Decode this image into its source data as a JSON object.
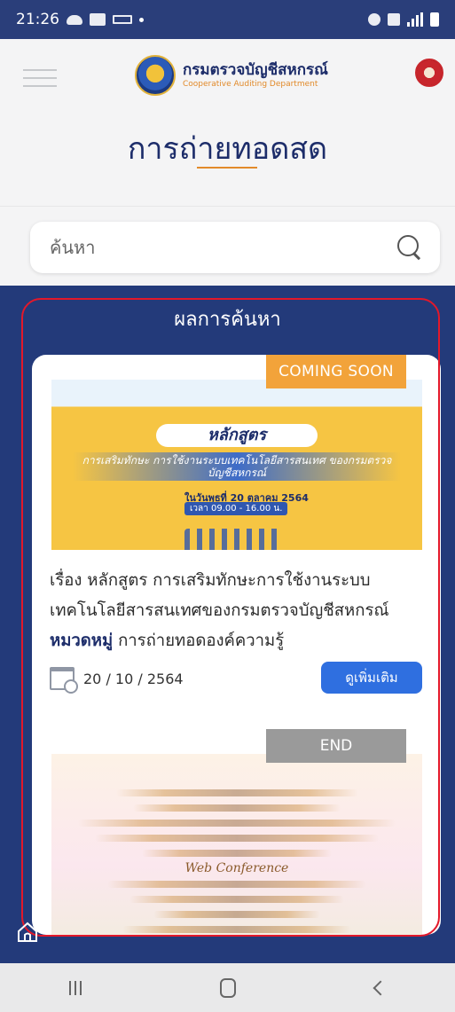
{
  "status_bar": {
    "time": "21:26"
  },
  "header": {
    "logo_th": "กรมตรวจบัญชีสหกรณ์",
    "logo_en": "Cooperative Auditing Department",
    "page_title": "การถ่ายทอดสด"
  },
  "search": {
    "placeholder": "ค้นหา"
  },
  "results": {
    "title": "ผลการค้นหา",
    "items": [
      {
        "tag": "COMING SOON",
        "banner": {
          "heading": "หลักสูตร",
          "subtitle": "การเสริมทักษะ การใช้งานระบบเทคโนโลยีสารสนเทศ ของกรมตรวจบัญชีสหกรณ์",
          "date": "ในวันพุธที่ 20 ตุลาคม 2564",
          "time": "เวลา 09.00 - 16.00 น."
        },
        "subject_label": "เรื่อง",
        "subject": "หลักสูตร การเสริมทักษะการใช้งานระบบเทคโนโลยีสารสนเทศของกรมตรวจบัญชีสหกรณ์",
        "category_label": "หมวดหมู่",
        "category": "การถ่ายทอดองค์ความรู้",
        "date": "20 / 10 / 2564",
        "more_label": "ดูเพิ่มเติม"
      },
      {
        "tag": "END",
        "banner": {
          "line1": "Web Conference"
        }
      }
    ]
  },
  "colors": {
    "primary_blue": "#233a7a",
    "accent_orange": "#e28a2a",
    "button_blue": "#2f6fe0",
    "outline_red": "#e3182a"
  },
  "icons": {
    "menu": "hamburger-icon",
    "search": "search-icon",
    "calendar": "calendar-icon",
    "home": "home-icon"
  }
}
